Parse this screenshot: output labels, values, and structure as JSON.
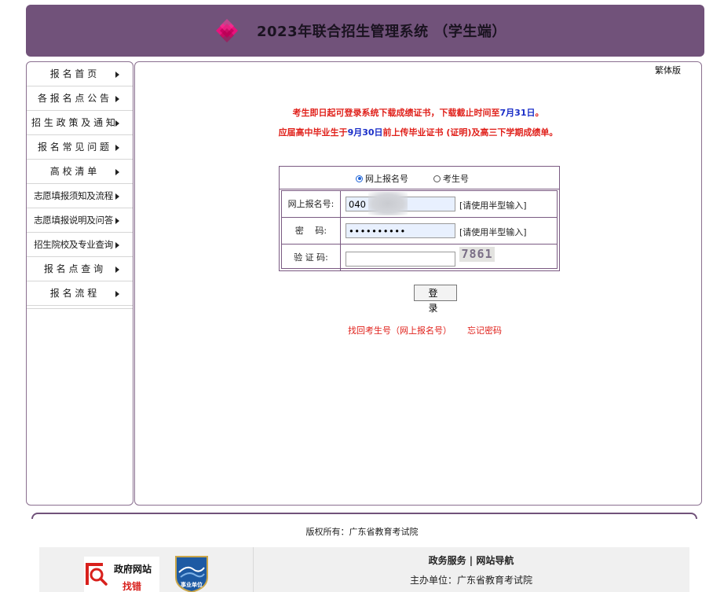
{
  "header": {
    "title": "2023年联合招生管理系统 （学生端）",
    "logo_icon": "diamond-logo-icon",
    "bg_color": "#71527a"
  },
  "sidebar": {
    "items": [
      {
        "label": "报 名 首 页"
      },
      {
        "label": "各 报 名 点 公 告"
      },
      {
        "label": "招 生 政 策 及 通 知"
      },
      {
        "label": "报 名 常 见 问 题"
      },
      {
        "label": "高 校 清 单"
      },
      {
        "label": "志愿填报须知及流程"
      },
      {
        "label": "志愿填报说明及问答"
      },
      {
        "label": "招生院校及专业查询"
      },
      {
        "label": "报 名 点 查 询"
      },
      {
        "label": "报 名 流 程"
      }
    ]
  },
  "main": {
    "traditional_link": "繁体版",
    "notice1": {
      "part1": "考生即日起可登录系统下载成绩证书，下载截止时间至",
      "date": "7月31日",
      "part2": "。"
    },
    "notice2": {
      "part1": "应届高中毕业生于",
      "date": "9月30日",
      "part2": "前上传毕业证书 (证明)及高三下学期成绩单。"
    },
    "login": {
      "radio_options": [
        {
          "label": "网上报名号",
          "checked": true
        },
        {
          "label": "考生号",
          "checked": false
        }
      ],
      "fields": {
        "reg_label": "网上报名号:",
        "reg_value": "040",
        "reg_hint": "[请使用半型输入]",
        "pwd_label": "密　 码:",
        "pwd_value": "••••••••••",
        "pwd_hint": "[请使用半型输入]",
        "captcha_label": "验 证 码:",
        "captcha_value": "",
        "captcha_image_text": "7861"
      },
      "login_button": "登 录"
    },
    "links": {
      "find_id": "找回考生号（网上报名号）",
      "forgot_pwd": "忘记密码"
    }
  },
  "footer": {
    "copyright": "版权所有：广东省教育考试院",
    "gov_badge": {
      "line1": "政府网站",
      "line2": "找错",
      "icon": "magnifier-icon"
    },
    "shiye_badge": {
      "text": "事业单位",
      "icon": "institution-emblem-icon"
    },
    "nav": {
      "service": "政务服务",
      "separator": " | ",
      "sitemap": "网站导航"
    },
    "host": "主办单位：广东省教育考试院"
  }
}
